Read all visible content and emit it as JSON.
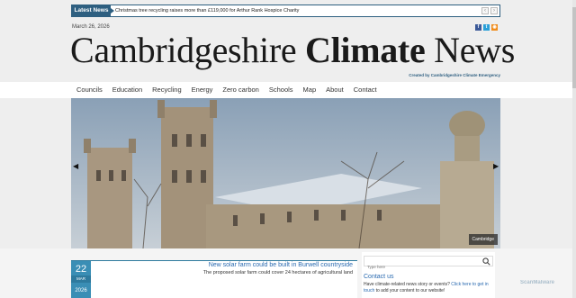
{
  "ticker": {
    "label": "Latest News",
    "headline": "Christmas tree recycling raises more than £119,000 for Arthur Rank Hospice Charity",
    "prev": "‹",
    "next": "›"
  },
  "header": {
    "date": "March 26, 2026",
    "title_part1": "Cambridgeshire ",
    "title_part2": "Climate",
    "title_part3": " News",
    "credit": "Created by Cambridgeshire Climate Emergency",
    "social": [
      "facebook-icon",
      "twitter-icon",
      "rss-icon"
    ]
  },
  "nav": {
    "items": [
      "Councils",
      "Education",
      "Recycling",
      "Energy",
      "Zero carbon",
      "Schools",
      "Map",
      "About",
      "Contact"
    ]
  },
  "hero": {
    "caption": "Cambridge",
    "left_arrow": "◀",
    "right_arrow": "▶"
  },
  "article": {
    "day": "22",
    "month": "MAR",
    "year": "2026",
    "title": "New solar farm could be built in Burwell countryside",
    "summary": "The proposed solar farm could cover 24 hectares of agricultural land"
  },
  "sidebar": {
    "search_placeholder": "Type here",
    "contact_title": "Contact us",
    "contact_text_before": "Have climate-related news story or events? ",
    "contact_link": "Click here to get in touch",
    "contact_text_after": " to add your content to our website!"
  },
  "badge": "ScanMalware",
  "colors": {
    "accent": "#2e5f80",
    "link": "#2a6ab0",
    "date_box": "#3a8eb5"
  }
}
